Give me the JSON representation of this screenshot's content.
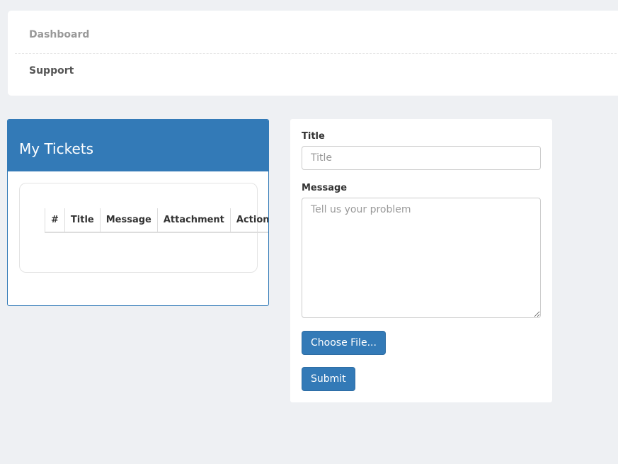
{
  "nav": {
    "items": [
      {
        "label": "Dashboard"
      },
      {
        "label": "Support"
      }
    ]
  },
  "tickets": {
    "heading": "My Tickets",
    "columns": [
      "#",
      "Title",
      "Message",
      "Attachment",
      "Actions"
    ],
    "rows": []
  },
  "form": {
    "title_label": "Title",
    "title_placeholder": "Title",
    "title_value": "",
    "message_label": "Message",
    "message_placeholder": "Tell us your problem",
    "message_value": "",
    "file_button_label": "Choose File...",
    "submit_label": "Submit"
  },
  "colors": {
    "primary": "#337ab7",
    "background": "#eef0f3"
  }
}
